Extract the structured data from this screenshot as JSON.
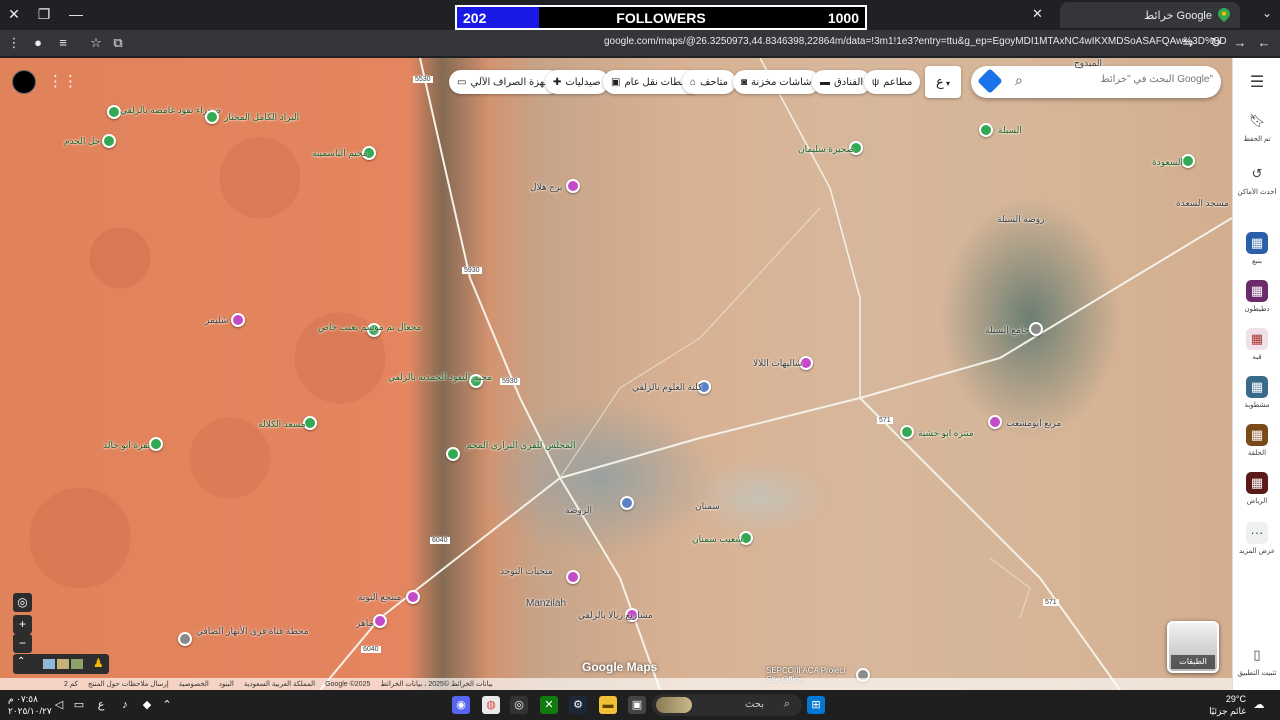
{
  "browser": {
    "tab_title": "خرائط Google",
    "url": "google.com/maps/@26.3250973,44.8346398,22864m/data=!3m1!1e3?entry=ttu&g_ep=EgoyMDI1MTAxNC4wIKXMDSoASAFQAw%3D%3D"
  },
  "stream_overlay": {
    "current": "202",
    "label": "FOLLOWERS",
    "goal": "1000",
    "progress": 0.202,
    "bar_color": "#1a1ae6"
  },
  "search": {
    "placeholder": "البحث في \"خرائط Google\"",
    "lang": "ع"
  },
  "categories": [
    {
      "label": "مطاعم",
      "icon": "fork-knife-icon"
    },
    {
      "label": "الفنادق",
      "icon": "bed-icon"
    },
    {
      "label": "شاشات مخزنة",
      "icon": "camera-icon"
    },
    {
      "label": "متاحف",
      "icon": "museum-icon"
    },
    {
      "label": "محطات نقل عام",
      "icon": "transit-icon"
    },
    {
      "label": "صيدليات",
      "icon": "pharmacy-icon"
    },
    {
      "label": "أجهزة الصراف الآلي",
      "icon": "atm-icon"
    }
  ],
  "places": [
    {
      "label": "صحراء نفود غامضة بالزلفي"
    },
    {
      "label": "البراد الكامل المختار"
    },
    {
      "label": "حل الحدم"
    },
    {
      "label": "مخيم الياسمينة"
    },
    {
      "label": "شليمر"
    },
    {
      "label": "محعال تم موسم بعنب خاص"
    },
    {
      "label": "مخيم النفود الحمدية بالزلفي"
    },
    {
      "label": "مسعد الكلالة"
    },
    {
      "label": "نفرة ابو خالد"
    },
    {
      "label": "المجلس للقرى البراري المخم"
    },
    {
      "label": "برج هلال"
    },
    {
      "label": "كلية العلوم بالزلفي"
    },
    {
      "label": "شاليهات اللالا"
    },
    {
      "label": "صحيرة سليمان"
    },
    {
      "label": "السبلة"
    },
    {
      "label": "السعودة"
    },
    {
      "label": "روضة السبلة"
    },
    {
      "label": "جامع السبلة"
    },
    {
      "label": "منتزه ابو خشبة"
    },
    {
      "label": "مربع ابومشعب"
    },
    {
      "label": "شعيب سمنان"
    },
    {
      "label": "سمنان"
    },
    {
      "label": "الروضة"
    },
    {
      "label": "منحيات التوحد"
    },
    {
      "label": "منتجع التونة"
    },
    {
      "label": "ماهر"
    },
    {
      "label": "محطة قناة قرى الأنهار الصافي"
    },
    {
      "label": "Manzilah"
    },
    {
      "label": "مشاريع ريالا بالزلفي"
    },
    {
      "label": "SEPCOIII ACA Project Site Office"
    },
    {
      "label": "مسجد السعدة"
    },
    {
      "label": "المبدوح"
    }
  ],
  "road_labels": [
    "5530",
    "5930",
    "571",
    "5930",
    "6040",
    "6040",
    "571"
  ],
  "map": {
    "watermark": "Google Maps",
    "layers_label": "الطبقات",
    "footer": [
      "بيانات الخرائط ©2025 ، بيانات الخرائط",
      "Google ©2025",
      "المملكة العربية السعودية",
      "البنود",
      "الخصوصية",
      "إرسال ملاحظات حول المنتج",
      "2 كم"
    ]
  },
  "sidebar": [
    {
      "label": "تم الحفظ",
      "icon": "bookmark-icon"
    },
    {
      "label": "أحدث الأماكن",
      "icon": "history-icon"
    },
    {
      "label": "بنبع",
      "icon": "recent-place-thumb"
    },
    {
      "label": "دطيطون",
      "icon": "recent-place-thumb"
    },
    {
      "label": "قبه",
      "icon": "recent-place-thumb"
    },
    {
      "label": "مشطوبة",
      "icon": "recent-place-thumb"
    },
    {
      "label": "الحلقة",
      "icon": "recent-place-thumb"
    },
    {
      "label": "الرياض",
      "icon": "recent-place-thumb"
    },
    {
      "label": "عرض المزيد",
      "icon": "more-icon"
    },
    {
      "label": "تثبيت التطبيق",
      "icon": "phone-icon"
    }
  ],
  "taskbar": {
    "time": "٠٧:٥٨ م",
    "date": "٢٠٢٥/١٠/٢٧",
    "search": "بحث",
    "weather_temp": "29°C",
    "weather_desc": "غائم جزئيًا"
  },
  "colors": {
    "desert": "#e0825a",
    "urban": "#9aa2a0",
    "pin_green": "#34a853",
    "pin_purple": "#c34bc5"
  }
}
